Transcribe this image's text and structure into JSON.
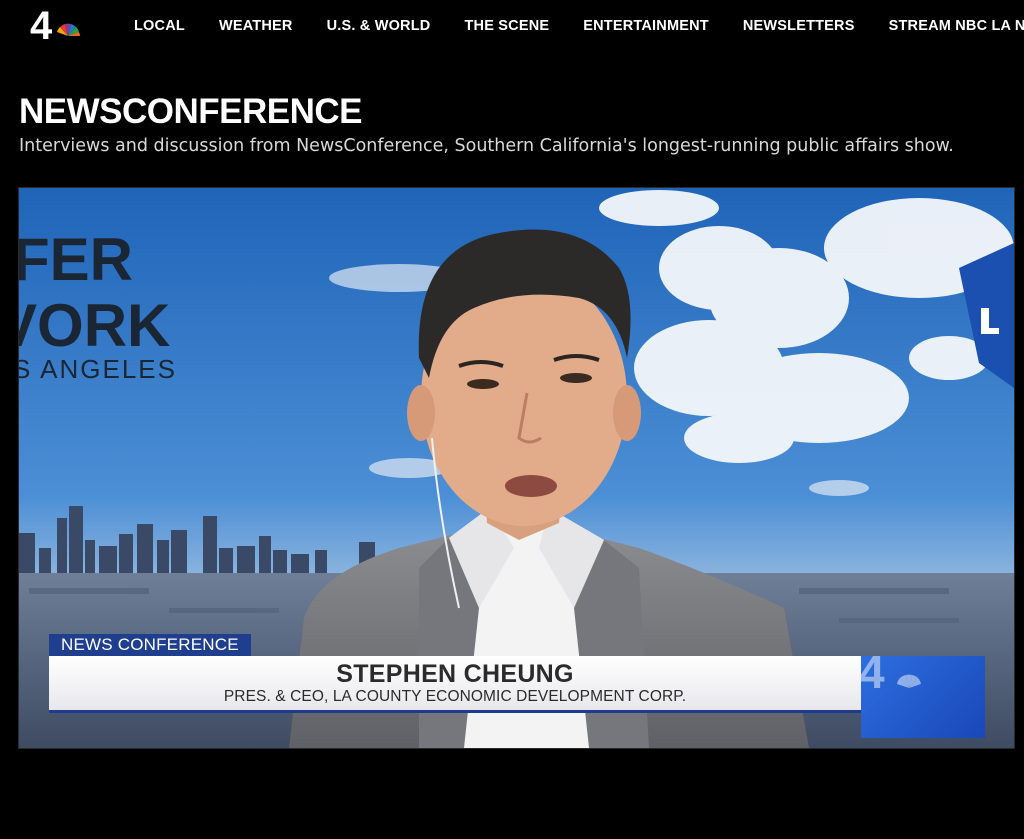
{
  "brand": {
    "logo_number": "4"
  },
  "nav": {
    "items": [
      {
        "label": "LOCAL"
      },
      {
        "label": "WEATHER"
      },
      {
        "label": "U.S. & WORLD"
      },
      {
        "label": "THE SCENE"
      },
      {
        "label": "ENTERTAINMENT"
      },
      {
        "label": "NEWSLETTERS"
      },
      {
        "label": "STREAM NBC LA NEWS"
      }
    ]
  },
  "page": {
    "title": "NEWSCONFERENCE",
    "subtitle": "Interviews and discussion from NewsConference, Southern California's longest-running public affairs show."
  },
  "video": {
    "background_text": {
      "line1": "FER",
      "line2": "VORK",
      "line3": "S ANGELES"
    },
    "lower_third": {
      "tag": "NEWS CONFERENCE",
      "name": "STEPHEN CHEUNG",
      "title": "PRES. & CEO,  LA COUNTY ECONOMIC DEVELOPMENT CORP."
    },
    "bug_logo_number": "4"
  },
  "colors": {
    "page_bg": "#000000",
    "lower_third_blue": "#1f3f8e",
    "sky_blue": "#2f74c4"
  }
}
